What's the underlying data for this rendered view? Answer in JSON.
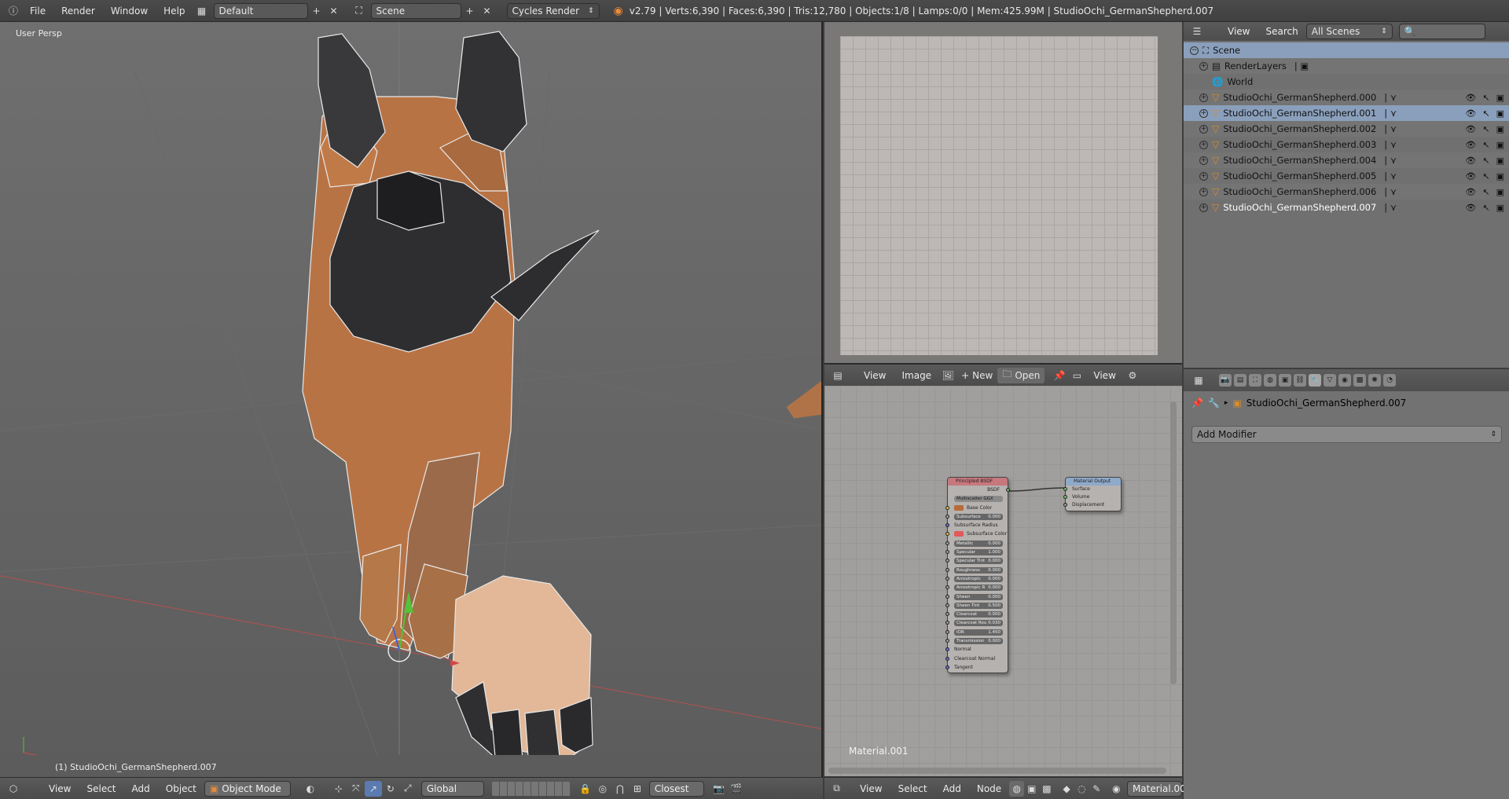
{
  "topbar": {
    "menus": [
      "File",
      "Render",
      "Window",
      "Help"
    ],
    "screen_layout": "Default",
    "scene": "Scene",
    "render_engine": "Cycles Render",
    "stats": "v2.79 | Verts:6,390 | Faces:6,390 | Tris:12,780 | Objects:1/8 | Lamps:0/0 | Mem:425.99M | StudioOchi_GermanShepherd.007"
  },
  "viewport": {
    "view_label": "User Persp",
    "active_object_label": "(1) StudioOchi_GermanShepherd.007",
    "header": {
      "menus": [
        "View",
        "Select",
        "Add",
        "Object"
      ],
      "mode": "Object Mode",
      "orientation": "Global",
      "snap_target": "Closest"
    }
  },
  "image_editor": {
    "header": {
      "menus": [
        "View",
        "Image"
      ],
      "new_label": "New",
      "open_label": "Open",
      "view_label": "View"
    }
  },
  "node_editor": {
    "material_label": "Material.001",
    "header": {
      "menus": [
        "View",
        "Select",
        "Add",
        "Node"
      ],
      "material_field": "Material.00"
    },
    "principled": {
      "title": "Principled BSDF",
      "output": "BSDF",
      "distribution": "Multiscatter GGX",
      "inputs": [
        {
          "label": "Base Color",
          "value": "",
          "kind": "color",
          "color": "#b86b3a"
        },
        {
          "label": "Subsurface",
          "value": "0.000",
          "kind": "field"
        },
        {
          "label": "Subsurface Radius",
          "value": "",
          "kind": "plain"
        },
        {
          "label": "Subsurface Color",
          "value": "",
          "kind": "color",
          "color": "#e05a5a"
        },
        {
          "label": "Metallic",
          "value": "0.000",
          "kind": "field"
        },
        {
          "label": "Specular",
          "value": "1.000",
          "kind": "field"
        },
        {
          "label": "Specular Tint",
          "value": "0.000",
          "kind": "field"
        },
        {
          "label": "Roughness",
          "value": "0.000",
          "kind": "field"
        },
        {
          "label": "Anisotropic",
          "value": "0.000",
          "kind": "field"
        },
        {
          "label": "Anisotropic R",
          "value": "0.000",
          "kind": "field"
        },
        {
          "label": "Sheen",
          "value": "0.000",
          "kind": "field"
        },
        {
          "label": "Sheen Tint",
          "value": "0.500",
          "kind": "field"
        },
        {
          "label": "Clearcoat",
          "value": "0.000",
          "kind": "field"
        },
        {
          "label": "Clearcoat Rou",
          "value": "0.030",
          "kind": "field"
        },
        {
          "label": "IOR",
          "value": "1.450",
          "kind": "field"
        },
        {
          "label": "Transmission",
          "value": "0.000",
          "kind": "field"
        },
        {
          "label": "Normal",
          "value": "",
          "kind": "plain"
        },
        {
          "label": "Clearcoat Normal",
          "value": "",
          "kind": "plain"
        },
        {
          "label": "Tangent",
          "value": "",
          "kind": "plain"
        }
      ]
    },
    "output_node": {
      "title": "Material Output",
      "inputs": [
        "Surface",
        "Volume",
        "Displacement"
      ]
    }
  },
  "outliner": {
    "header": {
      "view_label": "View",
      "search_label": "Search",
      "scenes_dropdown": "All Scenes"
    },
    "scene": "Scene",
    "render_layers": "RenderLayers",
    "world": "World",
    "objects": [
      "StudioOchi_GermanShepherd.000",
      "StudioOchi_GermanShepherd.001",
      "StudioOchi_GermanShepherd.002",
      "StudioOchi_GermanShepherd.003",
      "StudioOchi_GermanShepherd.004",
      "StudioOchi_GermanShepherd.005",
      "StudioOchi_GermanShepherd.006",
      "StudioOchi_GermanShepherd.007"
    ],
    "selected_index": 1,
    "active_index": 7
  },
  "properties": {
    "object_name": "StudioOchi_GermanShepherd.007",
    "add_modifier_label": "Add Modifier"
  },
  "colors": {
    "accent_selected": "#8a9fbb",
    "orange_object": "#d88b2c",
    "principled_header": "#c7787d",
    "output_header": "#8fa9c9"
  }
}
